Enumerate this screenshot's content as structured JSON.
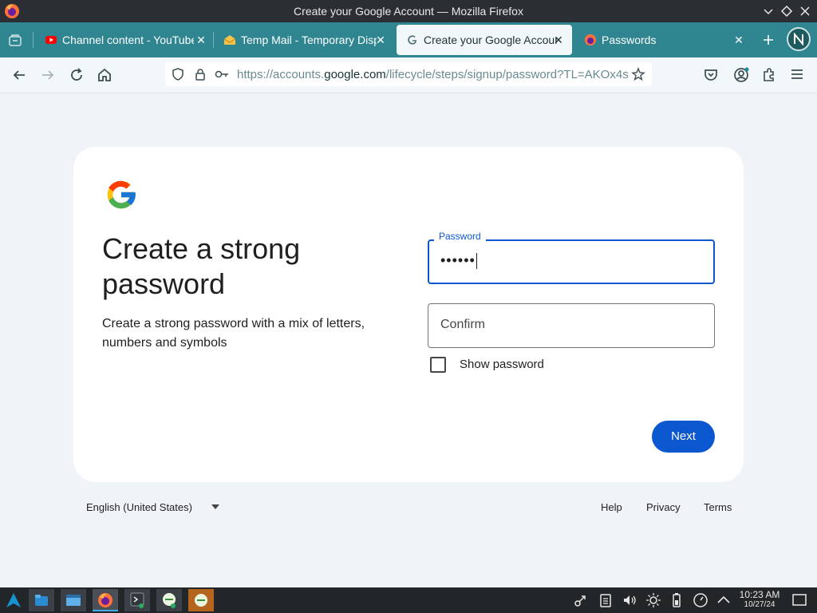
{
  "window": {
    "title": "Create your Google Account — Mozilla Firefox"
  },
  "tabs": [
    {
      "label": "Channel content - YouTube",
      "favicon": "youtube-icon",
      "active": false
    },
    {
      "label": "Temp Mail - Temporary Disposable Email",
      "favicon": "mail-envelope-icon",
      "active": false
    },
    {
      "label": "Create your Google Account",
      "favicon": "google-icon",
      "active": true
    },
    {
      "label": "Passwords",
      "favicon": "firefox-icon",
      "active": false
    }
  ],
  "toolbar": {
    "url_prefix": "https://accounts.",
    "url_domain": "google.com",
    "url_suffix": "/lifecycle/steps/signup/password?TL=AKOx4s"
  },
  "page": {
    "heading": "Create a strong password",
    "description": "Create a strong password with a mix of letters, numbers and symbols",
    "password_label": "Password",
    "password_value": "••••••",
    "confirm_placeholder": "Confirm",
    "show_password_label": "Show password",
    "show_password_checked": false,
    "next_label": "Next"
  },
  "footer": {
    "language": "English (United States)",
    "help": "Help",
    "privacy": "Privacy",
    "terms": "Terms"
  },
  "taskbar": {
    "time": "10:23 AM",
    "date": "10/27/24"
  },
  "colors": {
    "tab_bar": "#2f8590",
    "accent_blue": "#0b57d0",
    "page_bg": "#f0f4f9",
    "taskbar": "#232629"
  }
}
